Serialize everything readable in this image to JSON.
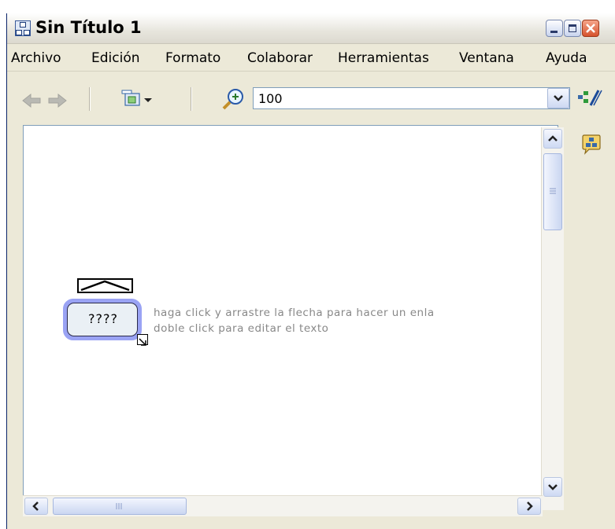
{
  "window": {
    "title": "Sin Título 1",
    "controls": [
      "minimize",
      "maximize",
      "close"
    ]
  },
  "menubar": {
    "items": [
      "Archivo",
      "Edición",
      "Formato",
      "Colaborar",
      "Herramientas",
      "Ventana",
      "Ayuda"
    ]
  },
  "toolbar": {
    "zoom_value": "100",
    "icons": [
      "back-arrow-icon",
      "forward-arrow-icon",
      "view-mode-icon",
      "zoom-icon",
      "styles-icon"
    ]
  },
  "canvas": {
    "concept_label": "????",
    "hint_line1": "haga click y arrastre la flecha para hacer un enla",
    "hint_line2": "doble click para editar el texto"
  },
  "colors": {
    "window_bg": "#ece9d8",
    "concept_selection": "#9aa3f4",
    "concept_fill": "#eaf0f5",
    "hint_text": "#888888",
    "close_button": "#d6532e"
  }
}
